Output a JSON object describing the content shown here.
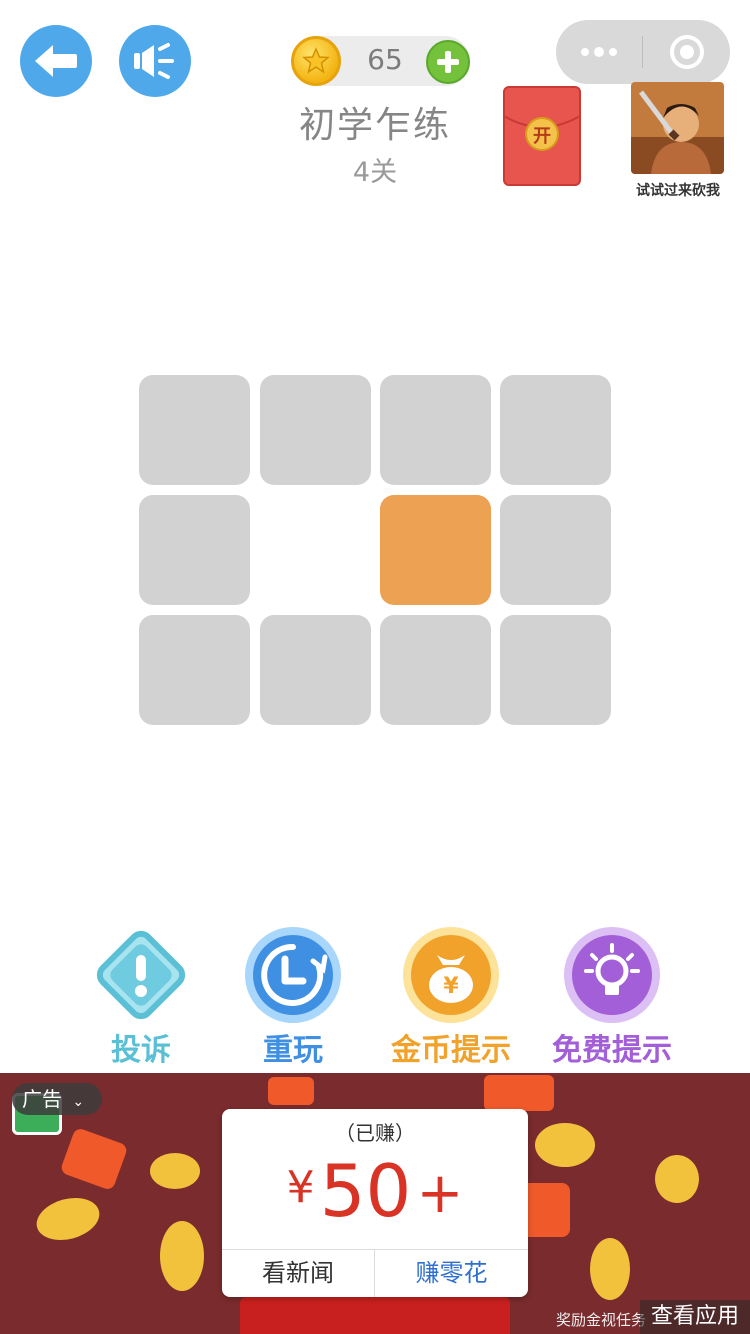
{
  "header": {
    "coins": "65",
    "level_title": "初学乍练",
    "level_number": "4关"
  },
  "promo": {
    "packet_label": "开",
    "game_label": "试试过来砍我"
  },
  "grid": {
    "rows": 3,
    "cols": 4,
    "cells": [
      "filled",
      "filled",
      "filled",
      "filled",
      "filled",
      "empty",
      "active",
      "filled",
      "filled",
      "filled",
      "filled",
      "filled"
    ]
  },
  "actions": [
    {
      "label": "投诉",
      "icon": "warning-icon",
      "color": "#5bbfd6"
    },
    {
      "label": "重玩",
      "icon": "replay-icon",
      "color": "#3f8fe3"
    },
    {
      "label": "金币提示",
      "icon": "money-bag-icon",
      "color": "#f0a22a"
    },
    {
      "label": "免费提示",
      "icon": "lightbulb-icon",
      "color": "#a25fd8"
    }
  ],
  "ad": {
    "tag": "广告",
    "earned": "（已赚）",
    "currency": "¥",
    "amount": "50",
    "plus": "+",
    "left_button": "看新闻",
    "right_button": "赚零花",
    "footer_text": "奖励金视任务",
    "view_button": "查看应用"
  },
  "colors": {
    "primary_blue": "#4ea8ea",
    "active_cell": "#eca153",
    "cell": "#d2d2d2",
    "ad_red": "#d93325"
  }
}
